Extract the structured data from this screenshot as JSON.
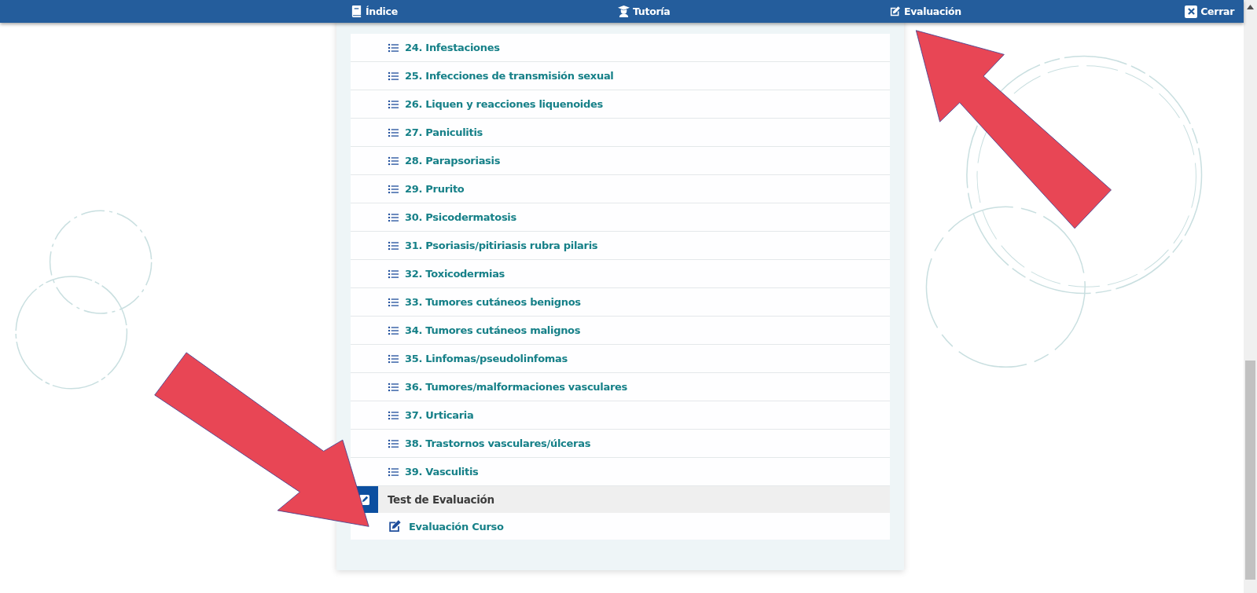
{
  "header": {
    "links": [
      {
        "label": "Índice",
        "kind": "book"
      },
      {
        "label": "Tutoría",
        "kind": "tutor"
      },
      {
        "label": "Evaluación",
        "kind": "edit"
      }
    ],
    "close": {
      "label": "Cerrar"
    }
  },
  "menu": {
    "items": [
      "24. Infestaciones",
      "25. Infecciones de transmisión sexual",
      "26. Liquen y reacciones liquenoides",
      "27. Paniculitis",
      "28. Parapsoriasis",
      "29. Prurito",
      "30. Psicodermatosis",
      "31. Psoriasis/pitiriasis rubra pilaris",
      "32. Toxicodermias",
      "33. Tumores cutáneos benignos",
      "34. Tumores cutáneos malignos",
      "35. Linfomas/pseudolinfomas",
      "36. Tumores/malformaciones vasculares",
      "37. Urticaria",
      "38. Trastornos vasculares/úlceras",
      "39. Vasculitis"
    ],
    "section": {
      "title": "Test de Evaluación",
      "items": [
        "Evaluación Curso"
      ]
    }
  }
}
